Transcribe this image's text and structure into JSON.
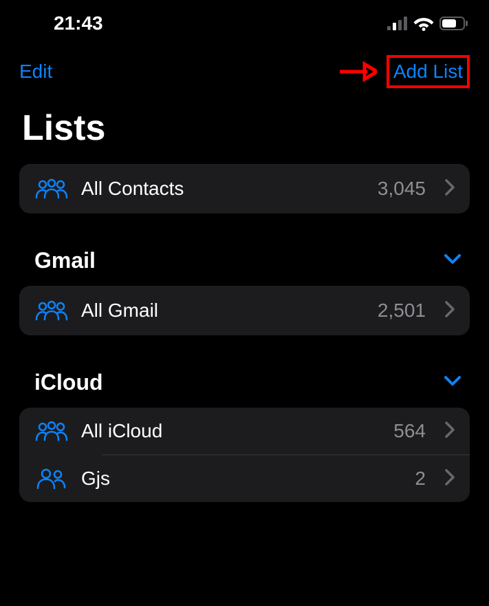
{
  "status": {
    "time": "21:43"
  },
  "nav": {
    "edit_label": "Edit",
    "add_list_label": "Add List"
  },
  "page_title": "Lists",
  "all_contacts": {
    "label": "All Contacts",
    "count": "3,045"
  },
  "sections": [
    {
      "title": "Gmail",
      "items": [
        {
          "label": "All Gmail",
          "count": "2,501",
          "icon": "group-3"
        }
      ]
    },
    {
      "title": "iCloud",
      "items": [
        {
          "label": "All iCloud",
          "count": "564",
          "icon": "group-3"
        },
        {
          "label": "Gjs",
          "count": "2",
          "icon": "group-2"
        }
      ]
    }
  ]
}
